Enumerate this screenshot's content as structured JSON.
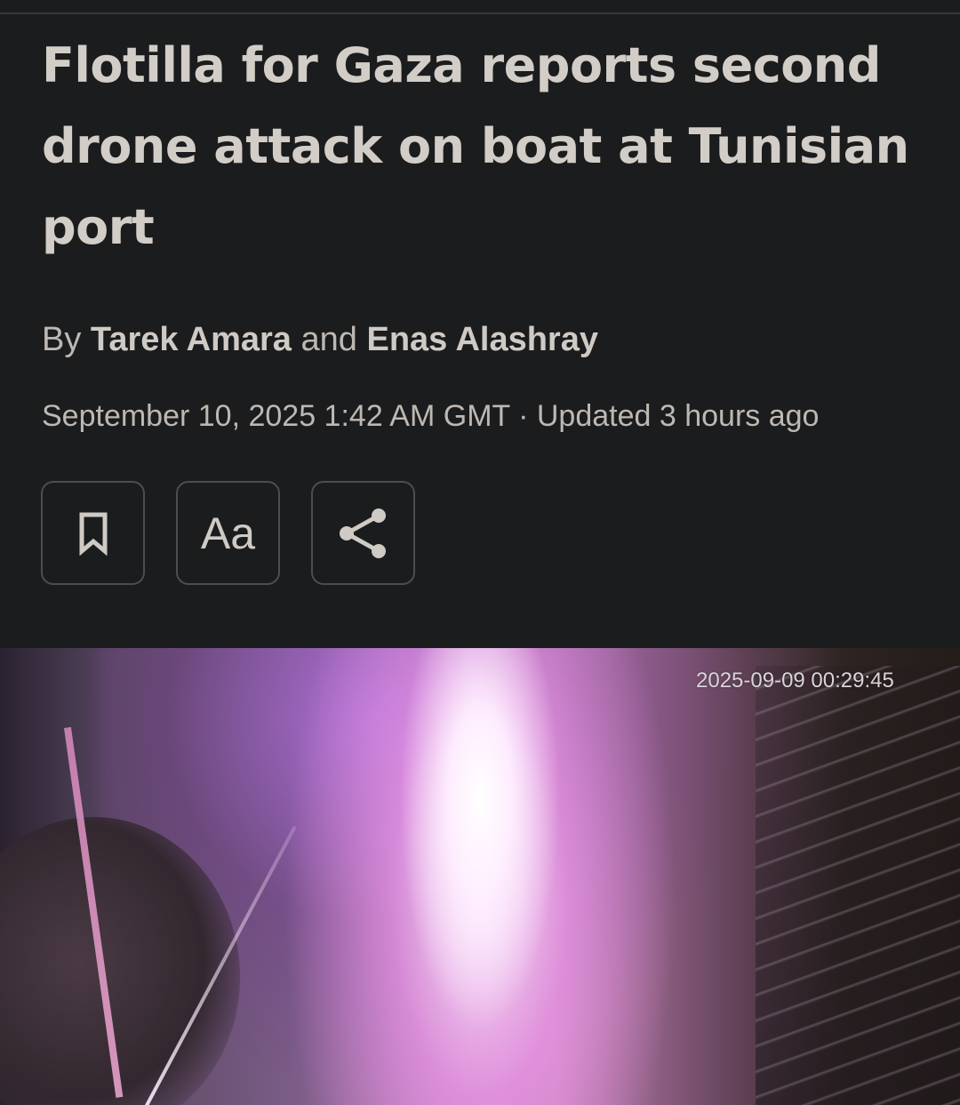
{
  "article": {
    "headline": "Flotilla for Gaza reports second drone attack on boat at Tunisian port",
    "byline": {
      "prefix": "By",
      "author_1": "Tarek Amara",
      "conjunction": "and",
      "author_2": "Enas Alashray"
    },
    "dateline": "September 10, 2025 1:42 AM GMT · Updated 3 hours ago"
  },
  "actions": {
    "bookmark_icon": "bookmark-icon",
    "font_size_label": "Aa",
    "share_icon": "share-icon"
  },
  "hero_image": {
    "camera_timestamp": "2025-09-09 00:29:45"
  },
  "colors": {
    "background": "#1b1c1e",
    "text": "#cfcac4",
    "button_border": "#4b4d52"
  }
}
